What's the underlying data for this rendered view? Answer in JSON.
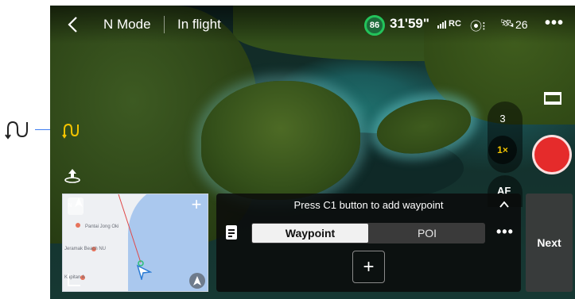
{
  "top_bar": {
    "flight_mode": "N Mode",
    "flight_status": "In flight",
    "battery_percent": "86",
    "flight_time": "31'59\"",
    "signal_label": "RC",
    "satellite_count": "26"
  },
  "camera": {
    "zoom_option_3": "3",
    "zoom_option_current": "1×",
    "focus_mode": "AF"
  },
  "minimap": {
    "place_1": "Pantai Jong Oki",
    "place_2": "Jeramak Beach NU",
    "place_3": "Kapitan A",
    "north_label": "N"
  },
  "waypoint_panel": {
    "hint": "Press C1 button to add waypoint",
    "tab_waypoint": "Waypoint",
    "tab_poi": "POI",
    "add_label": "+"
  },
  "next_label": "Next",
  "colors": {
    "accent_yellow": "#f2c300",
    "record_red": "#e52b2b",
    "battery_green": "#23c35b"
  }
}
